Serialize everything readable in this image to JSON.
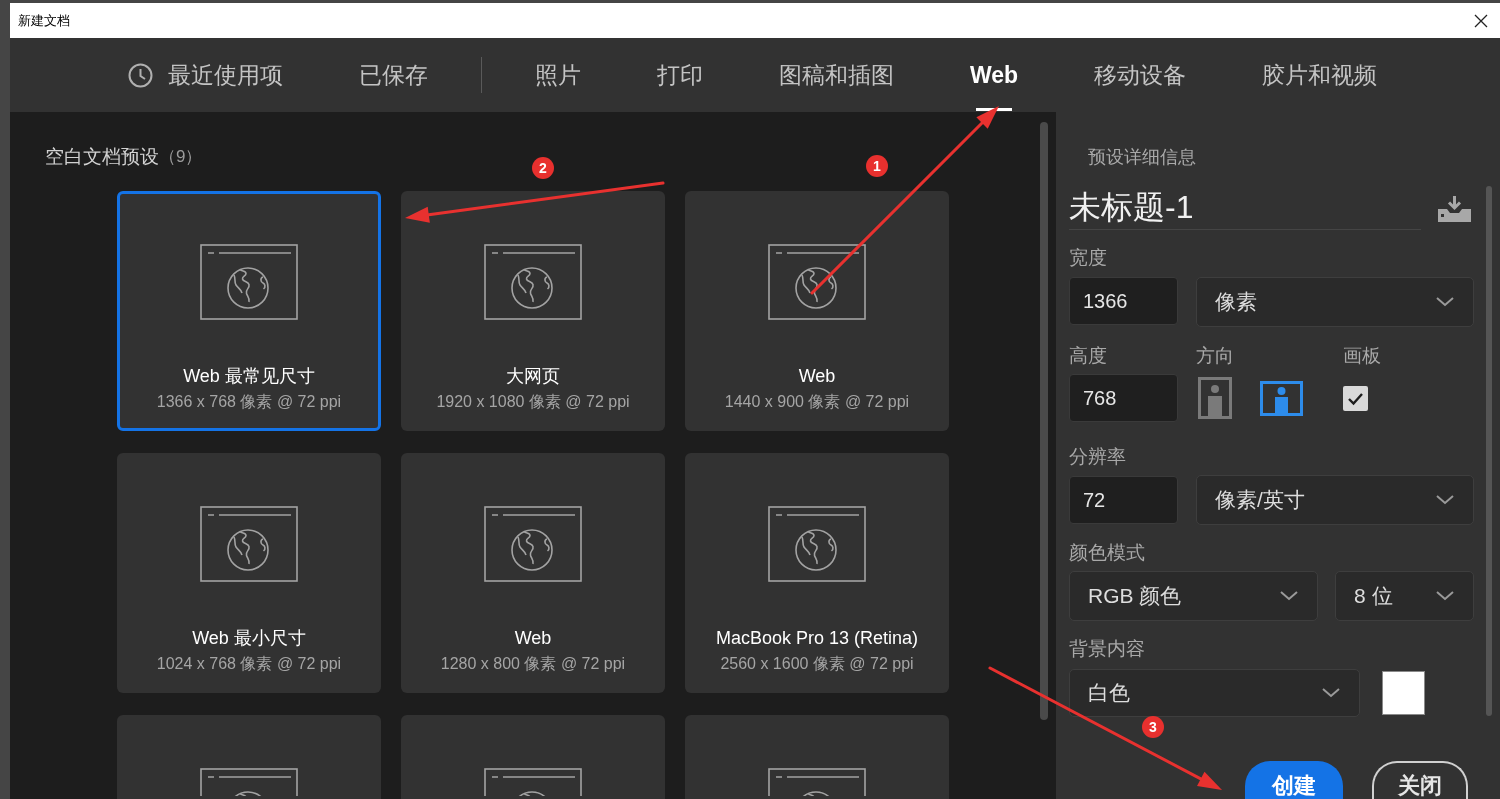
{
  "window": {
    "title": "新建文档"
  },
  "tabs": [
    {
      "label": "最近使用项",
      "kind": "recent",
      "selected": false
    },
    {
      "label": "已保存",
      "kind": "saved",
      "selected": false
    },
    {
      "label": "照片",
      "kind": "category",
      "selected": false
    },
    {
      "label": "打印",
      "kind": "category",
      "selected": false
    },
    {
      "label": "图稿和插图",
      "kind": "category",
      "selected": false
    },
    {
      "label": "Web",
      "kind": "category",
      "selected": true
    },
    {
      "label": "移动设备",
      "kind": "category",
      "selected": false
    },
    {
      "label": "胶片和视频",
      "kind": "category",
      "selected": false
    }
  ],
  "presets": {
    "title": "空白文档预设",
    "count": "（9）",
    "items": [
      {
        "title": "Web 最常见尺寸",
        "size": "1366 x 768 像素 @ 72 ppi",
        "selected": true
      },
      {
        "title": "大网页",
        "size": "1920 x 1080 像素 @ 72 ppi",
        "selected": false
      },
      {
        "title": "Web",
        "size": "1440 x 900 像素 @ 72 ppi",
        "selected": false
      },
      {
        "title": "Web 最小尺寸",
        "size": "1024 x 768 像素 @ 72 ppi",
        "selected": false
      },
      {
        "title": "Web",
        "size": "1280 x 800 像素 @ 72 ppi",
        "selected": false
      },
      {
        "title": "MacBook Pro 13 (Retina)",
        "size": "2560 x 1600 像素 @ 72 ppi",
        "selected": false
      },
      {
        "selected": false
      },
      {
        "selected": false
      },
      {
        "selected": false
      }
    ]
  },
  "details": {
    "heading": "预设详细信息",
    "document_name": "未标题-1",
    "width": {
      "label": "宽度",
      "value": "1366",
      "unit": "像素"
    },
    "height": {
      "label": "高度",
      "value": "768"
    },
    "orientation": {
      "label": "方向",
      "options": [
        {
          "kind": "portrait",
          "selected": false
        },
        {
          "kind": "landscape",
          "selected": true
        }
      ]
    },
    "artboard": {
      "label": "画板",
      "checked": true
    },
    "resolution": {
      "label": "分辨率",
      "value": "72",
      "unit": "像素/英寸"
    },
    "color_mode": {
      "label": "颜色模式",
      "mode": "RGB 颜色",
      "depth": "8 位"
    },
    "background": {
      "label": "背景内容",
      "value": "白色"
    }
  },
  "buttons": [
    {
      "label": "创建",
      "kind": "primary"
    },
    {
      "label": "关闭",
      "kind": "secondary"
    }
  ],
  "annotations": [
    {
      "number": "1"
    },
    {
      "number": "2"
    },
    {
      "number": "3"
    }
  ]
}
